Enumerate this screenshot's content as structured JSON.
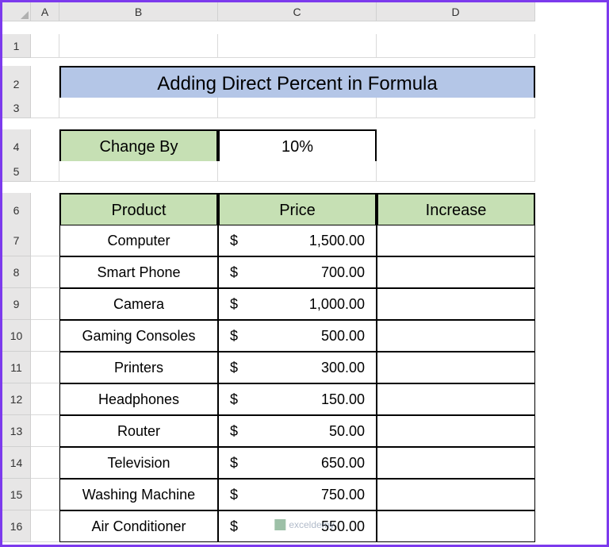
{
  "columns": [
    "",
    "A",
    "B",
    "C",
    "D"
  ],
  "rows": [
    "1",
    "2",
    "3",
    "4",
    "5",
    "6",
    "7",
    "8",
    "9",
    "10",
    "11",
    "12",
    "13",
    "14",
    "15",
    "16"
  ],
  "title": "Adding Direct Percent in Formula",
  "changeBy": {
    "label": "Change By",
    "value": "10%"
  },
  "headers": {
    "product": "Product",
    "price": "Price",
    "increase": "Increase"
  },
  "currency": "$",
  "products": [
    {
      "name": "Computer",
      "price": "1,500.00"
    },
    {
      "name": "Smart Phone",
      "price": "700.00"
    },
    {
      "name": "Camera",
      "price": "1,000.00"
    },
    {
      "name": "Gaming Consoles",
      "price": "500.00"
    },
    {
      "name": "Printers",
      "price": "300.00"
    },
    {
      "name": "Headphones",
      "price": "150.00"
    },
    {
      "name": "Router",
      "price": "50.00"
    },
    {
      "name": "Television",
      "price": "650.00"
    },
    {
      "name": "Washing Machine",
      "price": "750.00"
    },
    {
      "name": "Air Conditioner",
      "price": "550.00"
    }
  ],
  "watermark": "exceldemy"
}
